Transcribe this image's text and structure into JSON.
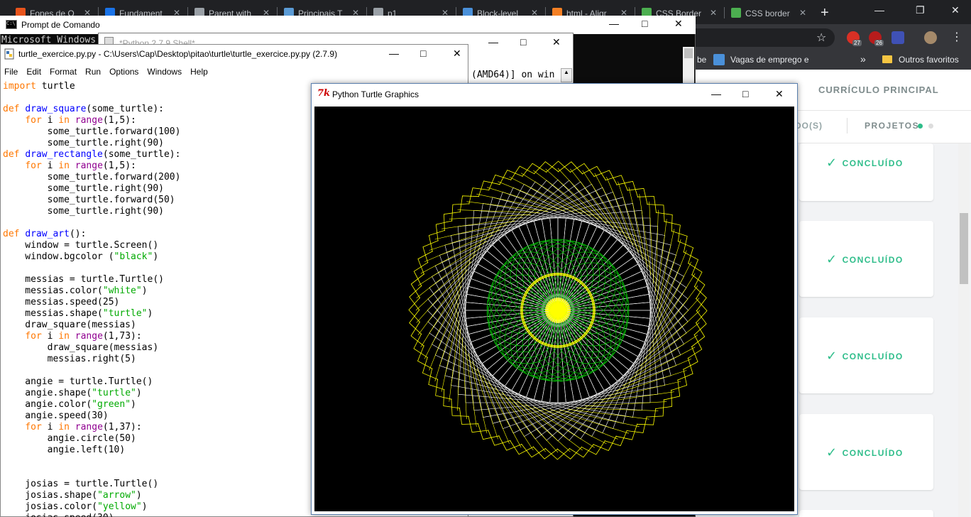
{
  "chrome": {
    "tabs": [
      {
        "label": "Fones de O",
        "color": "#e8541c"
      },
      {
        "label": "Fundament",
        "color": "#1a73e8"
      },
      {
        "label": "Parent with",
        "color": "#9aa0a6"
      },
      {
        "label": "Principais T",
        "color": "#5b9bd5"
      },
      {
        "label": "p1",
        "color": "#9aa0a6"
      },
      {
        "label": "Block-level",
        "color": "#4a90d9"
      },
      {
        "label": "html - Aligr",
        "color": "#f48024"
      },
      {
        "label": "CSS Border",
        "color": "#4caf50"
      },
      {
        "label": "CSS border",
        "color": "#4caf50"
      }
    ],
    "new_tab": "+",
    "bookmarks": {
      "partial": "be",
      "vagas": "Vagas de emprego e",
      "more": "»",
      "outros": "Outros favoritos"
    },
    "extensions": [
      {
        "badge": "27",
        "color": "#d93025"
      },
      {
        "badge": "26",
        "color": "#b71c1c"
      },
      {
        "badge": "",
        "color": "#3f51b5"
      }
    ]
  },
  "webpage": {
    "header": "CURRÍCULO PRINCIPAL",
    "tab_done": "DO(S)",
    "tab_projects": "PROJETOS",
    "cards": [
      {
        "status": "CONCLUÍDO"
      },
      {
        "status": "CONCLUÍDO"
      },
      {
        "status": "CONCLUÍDO"
      },
      {
        "status": "CONCLUÍDO"
      }
    ],
    "accent": "#2ebd8a"
  },
  "cmd": {
    "title": "Prompt de Comando",
    "text": "Microsoft Windows"
  },
  "shell": {
    "title": "*Python 2.7.9 Shell*",
    "line": "(AMD64)] on win"
  },
  "editor": {
    "title": "turtle_exercice.py.py - C:\\Users\\Cap\\Desktop\\pitao\\turtle\\turtle_exercice.py.py (2.7.9)",
    "menu": [
      "File",
      "Edit",
      "Format",
      "Run",
      "Options",
      "Windows",
      "Help"
    ]
  },
  "turtle_window": {
    "title": "Python Turtle Graphics",
    "icon": "7k",
    "bg": "#000000",
    "colors": {
      "white": "#ffffff",
      "green": "#00cc00",
      "yellow": "#ffff00"
    }
  }
}
